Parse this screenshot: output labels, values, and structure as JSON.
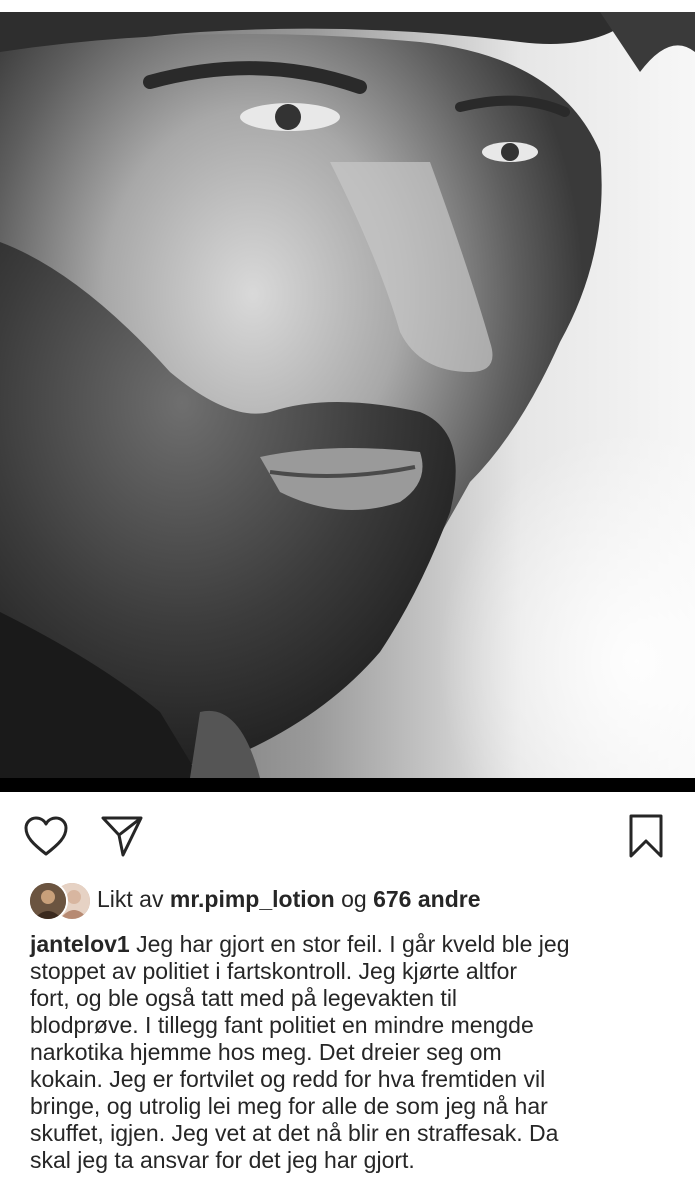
{
  "post": {
    "image_icon": "portrait-photo",
    "actions": {
      "like_icon": "heart-icon",
      "share_icon": "paper-plane-icon",
      "save_icon": "bookmark-icon"
    },
    "likes": {
      "prefix": "Likt av",
      "liker": "mr.pimp_lotion",
      "conjunction": "og",
      "others": "676 andre"
    },
    "caption": {
      "username": "jantelov1",
      "first_line_rest": "Jeg har gjort en stor feil. I går kveld ble jeg",
      "lines": [
        "stoppet av politiet i fartskontroll. Jeg kjørte altfor",
        "fort, og ble også tatt med på legevakten til",
        "blodprøve. I tillegg fant politiet en mindre mengde",
        "narkotika hjemme hos meg. Det dreier seg om",
        "kokain. Jeg er fortvilet og redd for hva fremtiden vil",
        "bringe, og utrolig lei meg for alle de som jeg nå har",
        "skuffet, igjen. Jeg vet at det nå blir en straffesak. Da",
        "skal jeg ta ansvar for det jeg har gjort."
      ]
    }
  }
}
